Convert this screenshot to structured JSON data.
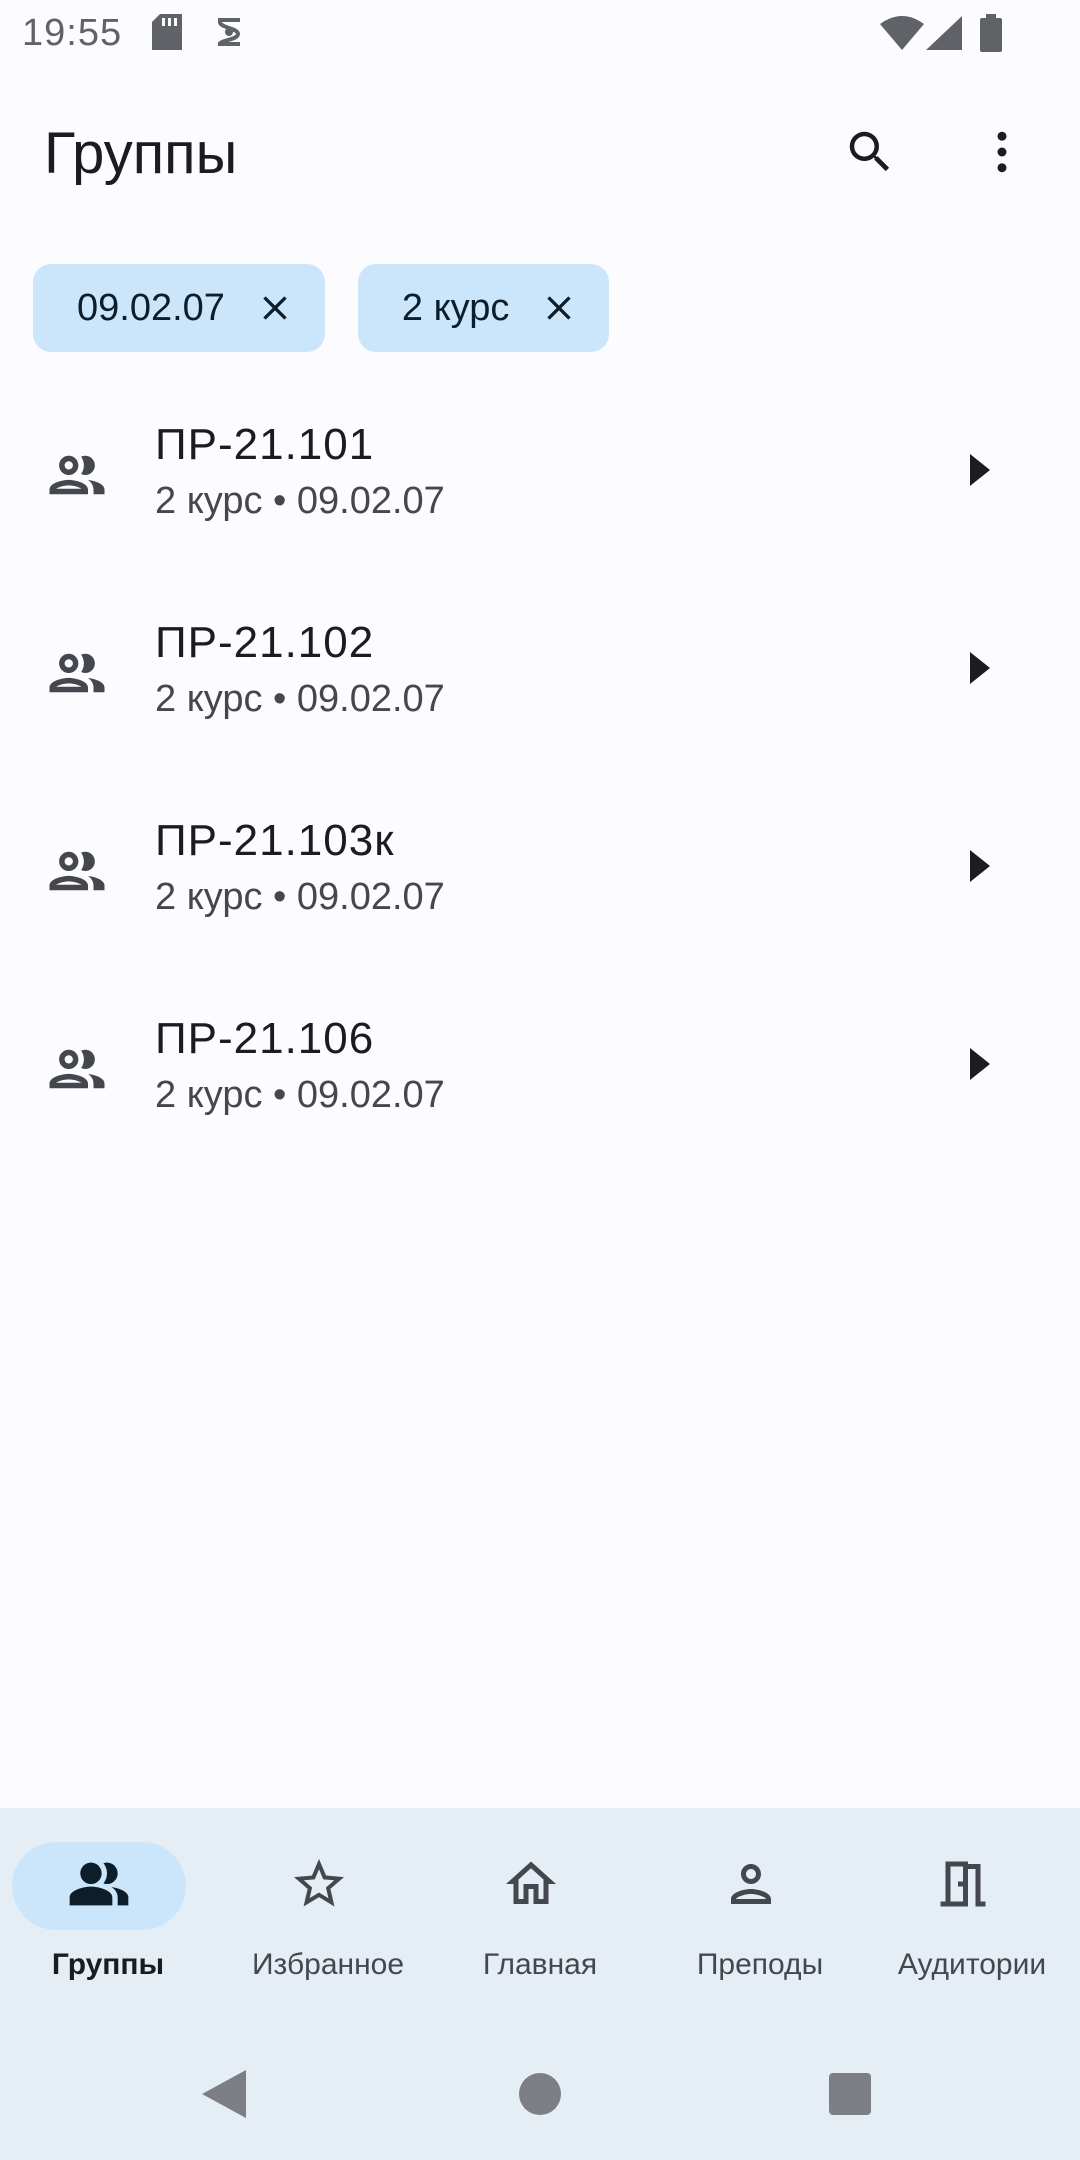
{
  "status_bar": {
    "time": "19:55",
    "icons": [
      "sd-card-icon",
      "sync-icon",
      "wifi-icon",
      "signal-icon",
      "battery-icon"
    ]
  },
  "app_bar": {
    "title": "Группы",
    "actions": [
      "search-icon",
      "more-vert-icon"
    ]
  },
  "filters": {
    "chips": [
      {
        "label": "09.02.07"
      },
      {
        "label": "2 курс"
      }
    ]
  },
  "groups": {
    "items": [
      {
        "title": "ПР-21.101",
        "subtitle": "2 курс • 09.02.07"
      },
      {
        "title": "ПР-21.102",
        "subtitle": "2 курс • 09.02.07"
      },
      {
        "title": "ПР-21.103к",
        "subtitle": "2 курс • 09.02.07"
      },
      {
        "title": "ПР-21.106",
        "subtitle": "2 курс • 09.02.07"
      }
    ]
  },
  "bottom_nav": {
    "items": [
      {
        "label": "Группы",
        "icon": "groups-icon",
        "selected": true
      },
      {
        "label": "Избранное",
        "icon": "star-icon",
        "selected": false
      },
      {
        "label": "Главная",
        "icon": "home-icon",
        "selected": false
      },
      {
        "label": "Преподы",
        "icon": "person-icon",
        "selected": false
      },
      {
        "label": "Аудитории",
        "icon": "door-icon",
        "selected": false
      }
    ]
  },
  "colors": {
    "background": "#fcfcff",
    "chip": "#cbe6fb",
    "nav_background": "#e5eef4",
    "nav_indicator": "#cbe6fb"
  }
}
